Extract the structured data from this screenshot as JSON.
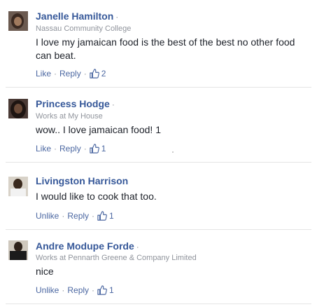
{
  "comments": [
    {
      "name": "Janelle Hamilton",
      "subtitle": "Nassau Community College",
      "text": "I love my jamaican food is the best of the best no other food can beat.",
      "action": "Like",
      "reply": "Reply",
      "likes": "2"
    },
    {
      "name": "Princess Hodge",
      "subtitle": "Works at My House",
      "text": "wow.. I love jamaican food! 1",
      "action": "Like",
      "reply": "Reply",
      "likes": "1"
    },
    {
      "name": "Livingston Harrison",
      "subtitle": "",
      "text": "I would like to cook that too.",
      "action": "Unlike",
      "reply": "Reply",
      "likes": "1"
    },
    {
      "name": "Andre Modupe Forde",
      "subtitle": "Works at Pennarth Greene & Company Limited",
      "text": "nice",
      "action": "Unlike",
      "reply": "Reply",
      "likes": "1"
    }
  ],
  "separator": "·",
  "colors": {
    "name": "#365899",
    "link": "#4b67a1",
    "muted": "#90949c",
    "text": "#1d2129"
  },
  "icons": {
    "like": "thumbs-up-icon"
  }
}
